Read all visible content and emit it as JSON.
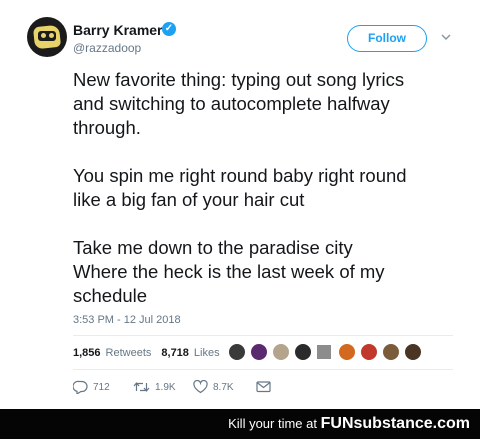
{
  "tweet": {
    "author": {
      "name": "Barry Kramer",
      "handle": "@razzadoop",
      "verified": true
    },
    "follow_label": "Follow",
    "text_paragraphs": [
      [
        "New favorite thing: typing out song lyrics",
        "and switching to autocomplete halfway",
        "through."
      ],
      [
        "You spin me right round baby right round",
        "like a big fan of your hair cut"
      ],
      [
        "Take me down to the paradise city",
        "Where the heck is the last week of my",
        "schedule"
      ]
    ],
    "timestamp": "3:53 PM - 12 Jul 2018",
    "stats": {
      "retweets_count": "1,856",
      "retweets_label": "Retweets",
      "likes_count": "8,718",
      "likes_label": "Likes"
    },
    "actions": {
      "replies": "712",
      "retweets": "1.9K",
      "likes": "8.7K"
    },
    "icons": {
      "verified": "verified-badge-icon",
      "caret": "chevron-down-icon",
      "reply": "reply-icon",
      "retweet": "retweet-icon",
      "like": "heart-icon",
      "dm": "envelope-icon"
    },
    "colors": {
      "accent": "#1da1f2",
      "secondary_text": "#657786",
      "primary_text": "#14171a"
    }
  },
  "watermark": {
    "prefix": "Kill your time at",
    "brand": "FUNsubstance.com"
  }
}
